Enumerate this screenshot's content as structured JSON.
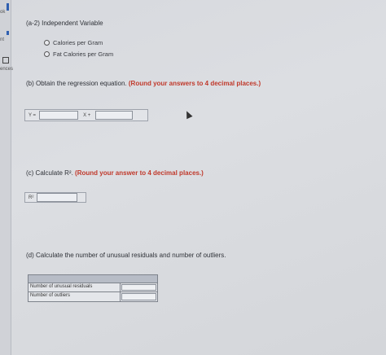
{
  "sidebar": {
    "item_1": "ok",
    "item_2": "nt",
    "item_3": "ences"
  },
  "section_a2": {
    "title": "(a-2) Independent Variable",
    "options": [
      "Calories per Gram",
      "Fat Calories per Gram"
    ]
  },
  "section_b": {
    "prefix": "(b) Obtain the regression equation.",
    "instruction": "(Round your answers to 4 decimal places.)",
    "y_label": "Y =",
    "x_label": "X +"
  },
  "section_c": {
    "prefix": "(c) Calculate R².",
    "instruction": "(Round your answer to 4 decimal places.)",
    "r2_label": "R²"
  },
  "section_d": {
    "title": "(d) Calculate the number of unusual residuals and number of outliers.",
    "rows": [
      "Number of unusual residuals",
      "Number of outliers"
    ]
  }
}
